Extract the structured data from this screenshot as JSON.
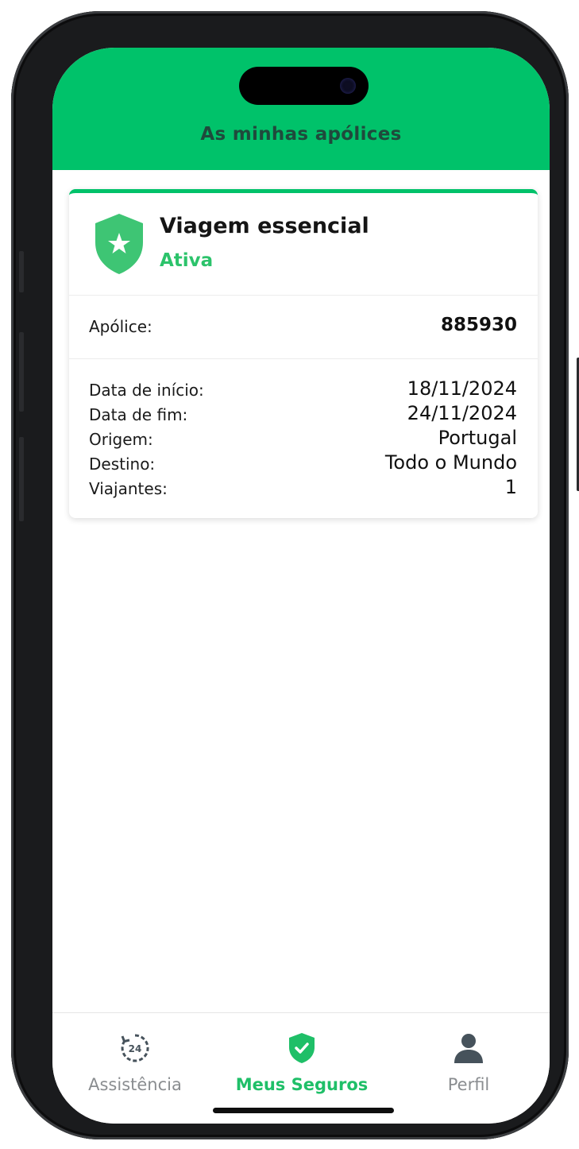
{
  "header": {
    "title": "As minhas apólices"
  },
  "policy_card": {
    "title": "Viagem essencial",
    "status": "Ativa",
    "policy_label": "Apólice:",
    "policy_number": "885930",
    "details": [
      {
        "label": "Data de início:",
        "value": "18/11/2024"
      },
      {
        "label": "Data de fim:",
        "value": "24/11/2024"
      },
      {
        "label": "Origem:",
        "value": "Portugal"
      },
      {
        "label": "Destino:",
        "value": "Todo o Mundo"
      },
      {
        "label": "Viajantes:",
        "value": "1"
      }
    ]
  },
  "bottom_nav": {
    "items": [
      {
        "label": "Assistência",
        "icon": "assistance-24h-icon",
        "active": false
      },
      {
        "label": "Meus Seguros",
        "icon": "shield-check-icon",
        "active": true
      },
      {
        "label": "Perfil",
        "icon": "user-icon",
        "active": false
      }
    ]
  },
  "colors": {
    "brand_green": "#00c26a",
    "status_green": "#2cc36b",
    "header_text": "#1f4a3c",
    "inactive_nav": "#8a8d90"
  }
}
